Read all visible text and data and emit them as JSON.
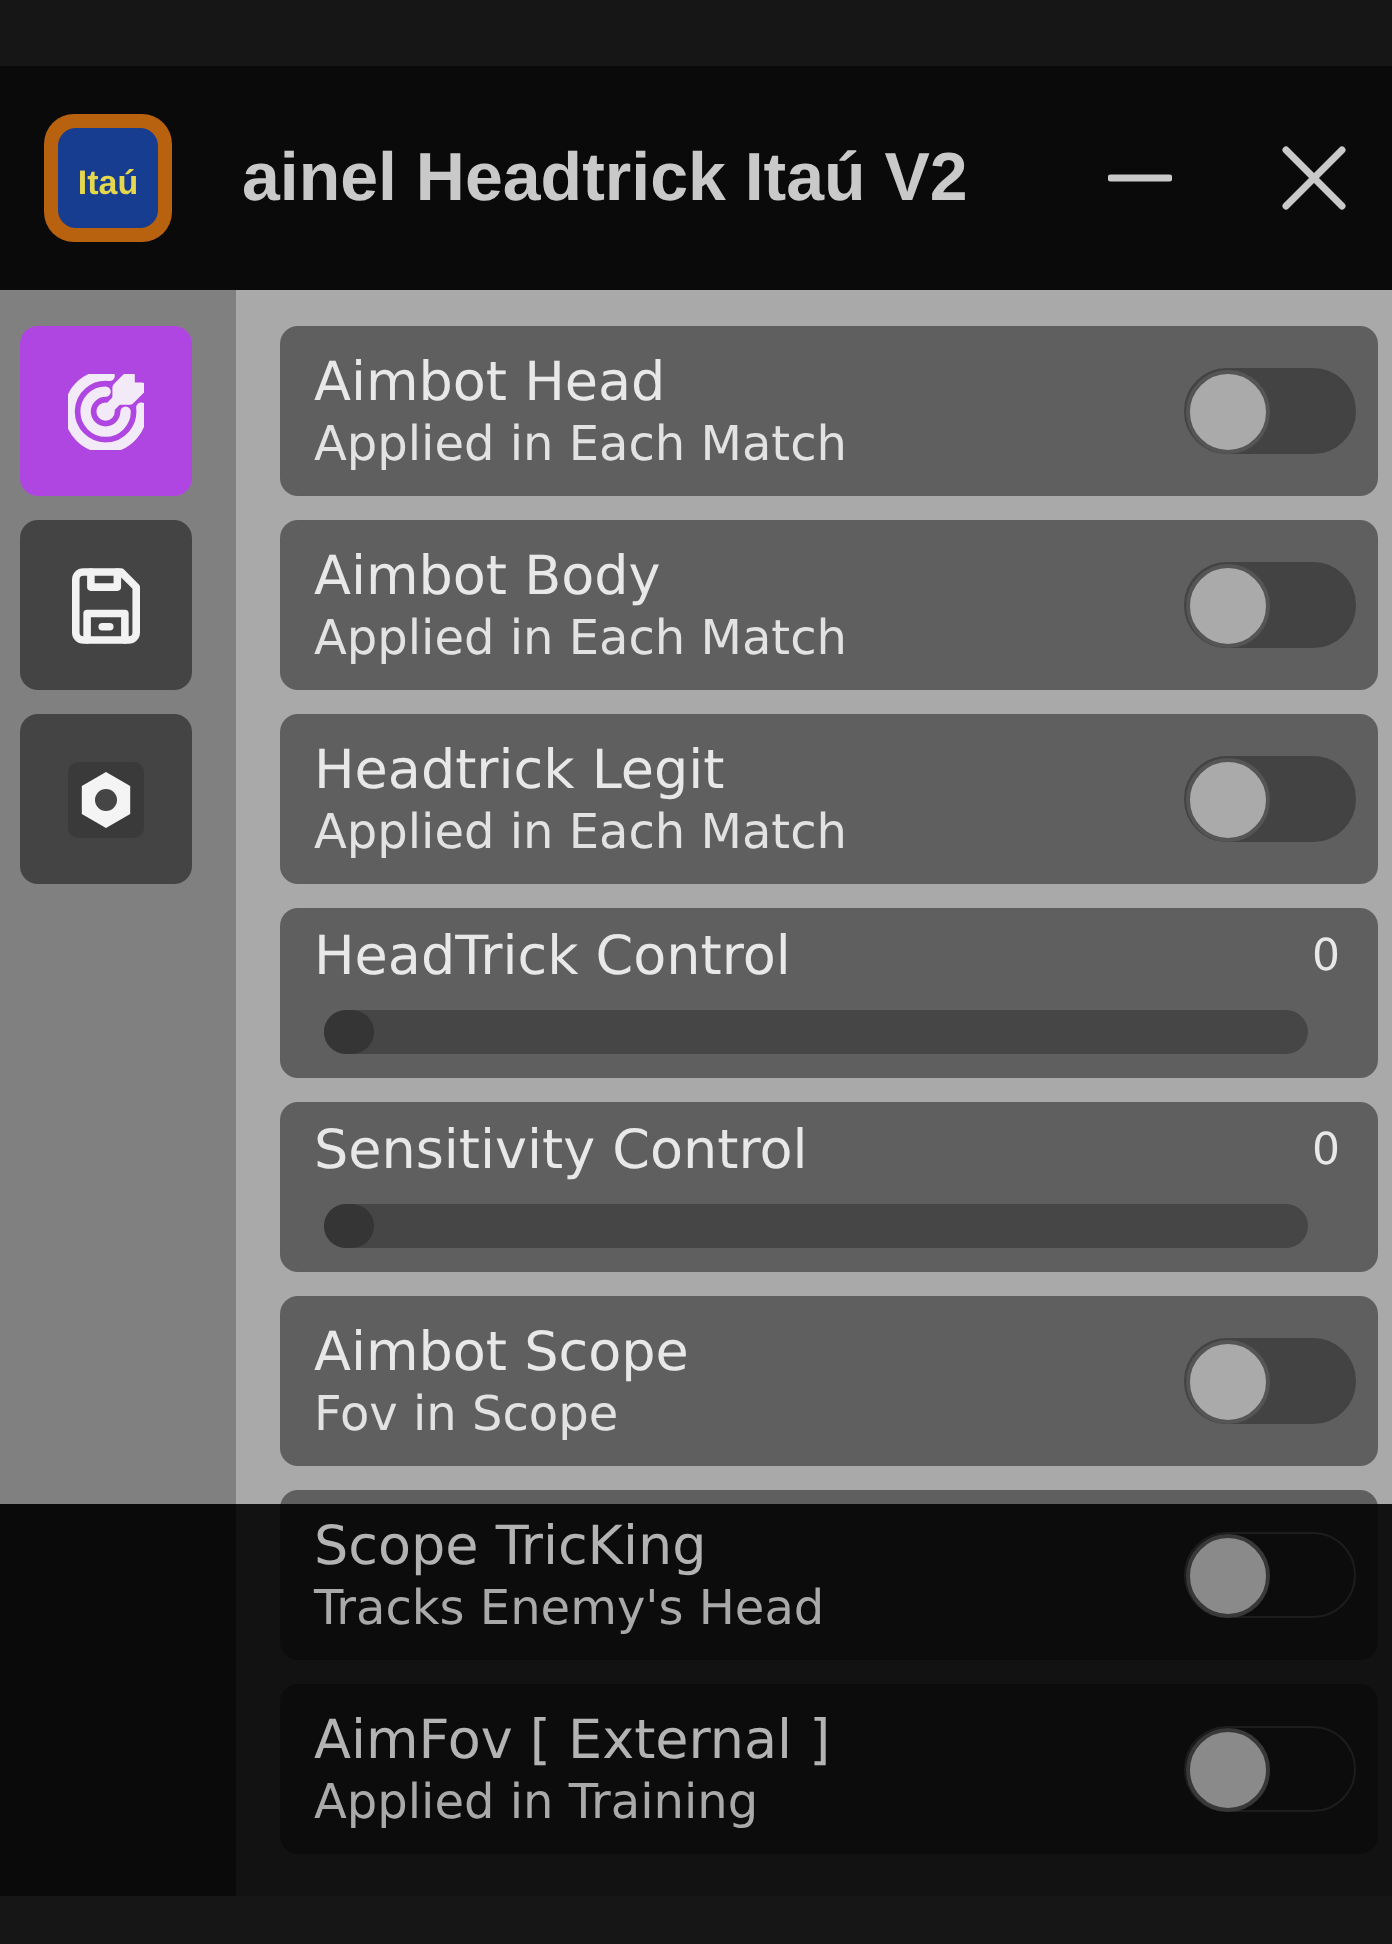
{
  "window": {
    "logo_text": "Itaú",
    "title": "ainel Headtrick Itaú V2"
  },
  "sidebar": {
    "items": [
      {
        "selected": true
      },
      {
        "selected": false
      },
      {
        "selected": false
      }
    ]
  },
  "settings": [
    {
      "kind": "toggle",
      "title": "Aimbot Head",
      "subtitle": "Applied in Each Match",
      "on": false
    },
    {
      "kind": "toggle",
      "title": "Aimbot Body",
      "subtitle": "Applied in Each Match",
      "on": false
    },
    {
      "kind": "toggle",
      "title": "Headtrick Legit",
      "subtitle": "Applied in Each Match",
      "on": false
    },
    {
      "kind": "slider",
      "title": "HeadTrick Control",
      "value": "0",
      "level": 0
    },
    {
      "kind": "slider",
      "title": "Sensitivity Control",
      "value": "0",
      "level": 0
    },
    {
      "kind": "toggle",
      "title": "Aimbot Scope",
      "subtitle": "Fov in Scope",
      "on": false
    },
    {
      "kind": "toggle",
      "title": "Scope TricKing",
      "subtitle": "Tracks Enemy's Head",
      "on": false
    },
    {
      "kind": "toggle",
      "title": "AimFov [ External ]",
      "subtitle": "Applied in Training",
      "on": false
    }
  ]
}
